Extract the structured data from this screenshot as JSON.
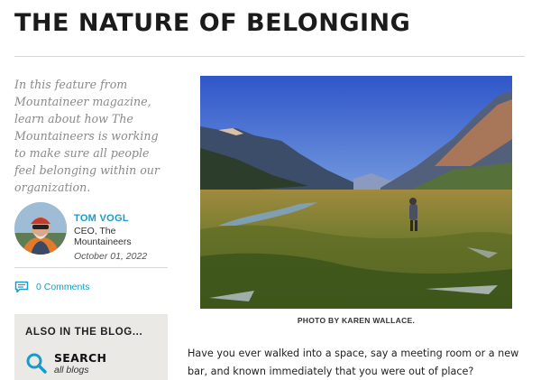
{
  "article": {
    "title": "THE NATURE OF BELONGING",
    "intro": "In this feature from Mountaineer magazine, learn about how The Mountaineers is working to make sure all people feel belonging within our organization.",
    "author": {
      "name": "TOM VOGL",
      "role": "CEO, The Mountaineers",
      "date": "October 01, 2022"
    },
    "comments_label": "0 Comments",
    "photo_credit": "PHOTO BY KAREN WALLACE.",
    "body_first": "Have you ever walked into a space, say a meeting room or a new bar, and known immediately that you were out of place?"
  },
  "also_in_blog": {
    "title": "ALSO IN THE BLOG...",
    "search_label": "SEARCH",
    "search_sub": "all blogs"
  },
  "icons": {
    "comments": "speech-bubble-icon",
    "search": "magnifier-icon"
  },
  "colors": {
    "accent": "#1a9bc7",
    "intro_text": "#8a8a8a",
    "sidebar_box": "#ebe9e6"
  }
}
